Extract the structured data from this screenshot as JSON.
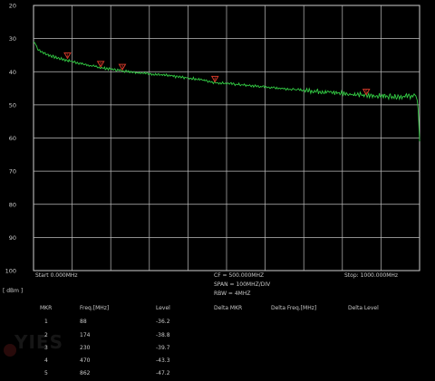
{
  "chart_data": {
    "type": "line",
    "y_ticks": [
      "20",
      "30",
      "40",
      "50",
      "60",
      "70",
      "80",
      "90",
      "100"
    ],
    "y_unit": "[ dBm ]",
    "ylim": [
      -100,
      -20
    ],
    "xlim": [
      0,
      1000
    ],
    "grid": true,
    "series": [
      {
        "color": "#33cc44",
        "x": [
          0,
          5,
          10,
          20,
          40,
          60,
          88,
          110,
          140,
          174,
          200,
          230,
          260,
          300,
          350,
          400,
          440,
          470,
          500,
          550,
          600,
          650,
          700,
          750,
          800,
          862,
          900,
          950,
          990,
          995,
          998,
          1000
        ],
        "y": [
          -31.0,
          -31.5,
          -33.0,
          -34.0,
          -35.0,
          -35.8,
          -36.6,
          -37.2,
          -38.0,
          -38.8,
          -39.2,
          -39.7,
          -40.1,
          -40.6,
          -41.2,
          -41.9,
          -42.5,
          -43.3,
          -43.5,
          -44.1,
          -44.6,
          -45.1,
          -45.6,
          -46.0,
          -46.5,
          -47.2,
          -47.3,
          -47.5,
          -47.2,
          -49.0,
          -55.0,
          -61.0
        ]
      }
    ],
    "markers": [
      {
        "id": "1",
        "x": 88,
        "y": -36.2
      },
      {
        "id": "2",
        "x": 174,
        "y": -38.8
      },
      {
        "id": "3",
        "x": 230,
        "y": -39.7
      },
      {
        "id": "4",
        "x": 470,
        "y": -43.3
      },
      {
        "id": "5",
        "x": 862,
        "y": -47.2
      }
    ]
  },
  "sweep": {
    "start": "Start  0.000MHz",
    "cf": "CF = 500.000MHZ",
    "span": "SPAN = 100MHZ/DIV",
    "rbw": "RBW = 4MHZ",
    "stop": "Stop:  1000.000MHz"
  },
  "marker_table": {
    "headers": [
      "MKR",
      "Freq.[MHz]",
      "Level",
      "Delta MKR",
      "Delta Freq.[MHz]",
      "Delta Level"
    ],
    "rows": [
      {
        "mkr": "1",
        "freq": "88",
        "level": "-36.2"
      },
      {
        "mkr": "2",
        "freq": "174",
        "level": "-38.8"
      },
      {
        "mkr": "3",
        "freq": "230",
        "level": "-39.7"
      },
      {
        "mkr": "4",
        "freq": "470",
        "level": "-43.3"
      },
      {
        "mkr": "5",
        "freq": "862",
        "level": "-47.2"
      }
    ]
  },
  "watermark": "YIES"
}
